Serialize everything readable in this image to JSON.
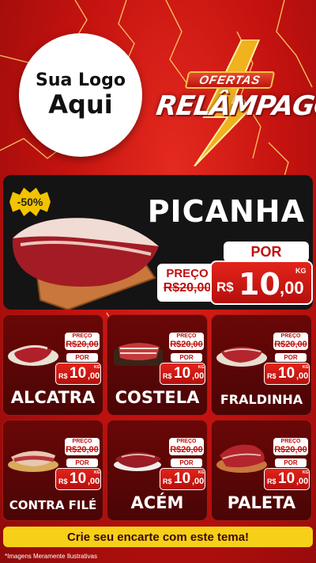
{
  "logo": {
    "line1": "Sua Logo",
    "line2": "Aqui"
  },
  "promo": {
    "badge": "OFERTAS",
    "title": "RELÂMPAGO"
  },
  "hero": {
    "discount": "-50%",
    "name": "PICANHA",
    "preco_label": "PREÇO",
    "old_price": "R$20,00",
    "por_label": "POR",
    "currency": "R$",
    "price_int": "10",
    "price_dec": ",00",
    "unit": "KG"
  },
  "products": [
    {
      "name": "ALCATRA",
      "preco_label": "PREÇO",
      "old_price": "R$20,00",
      "por_label": "POR",
      "currency": "R$",
      "price_int": "10",
      "price_dec": ",00",
      "unit": "KG"
    },
    {
      "name": "COSTELA",
      "preco_label": "PREÇO",
      "old_price": "R$20,00",
      "por_label": "POR",
      "currency": "R$",
      "price_int": "10",
      "price_dec": ",00",
      "unit": "KG"
    },
    {
      "name": "FRALDINHA",
      "preco_label": "PREÇO",
      "old_price": "R$20,00",
      "por_label": "POR",
      "currency": "R$",
      "price_int": "10",
      "price_dec": ",00",
      "unit": "KG"
    },
    {
      "name": "CONTRA FILÉ",
      "preco_label": "PREÇO",
      "old_price": "R$20,00",
      "por_label": "POR",
      "currency": "R$",
      "price_int": "10",
      "price_dec": ",00",
      "unit": "KG"
    },
    {
      "name": "ACÉM",
      "preco_label": "PREÇO",
      "old_price": "R$20,00",
      "por_label": "POR",
      "currency": "R$",
      "price_int": "10",
      "price_dec": ",00",
      "unit": "KG"
    },
    {
      "name": "PALETA",
      "preco_label": "PREÇO",
      "old_price": "R$20,00",
      "por_label": "POR",
      "currency": "R$",
      "price_int": "10",
      "price_dec": ",00",
      "unit": "KG"
    }
  ],
  "cta": "Crie seu encarte com este tema!",
  "footnote": "*Imagens Meramente Ilustrativas",
  "colors": {
    "brand_red": "#c4120f",
    "accent_yellow": "#f6cf19",
    "panel_dark": "#141414"
  }
}
